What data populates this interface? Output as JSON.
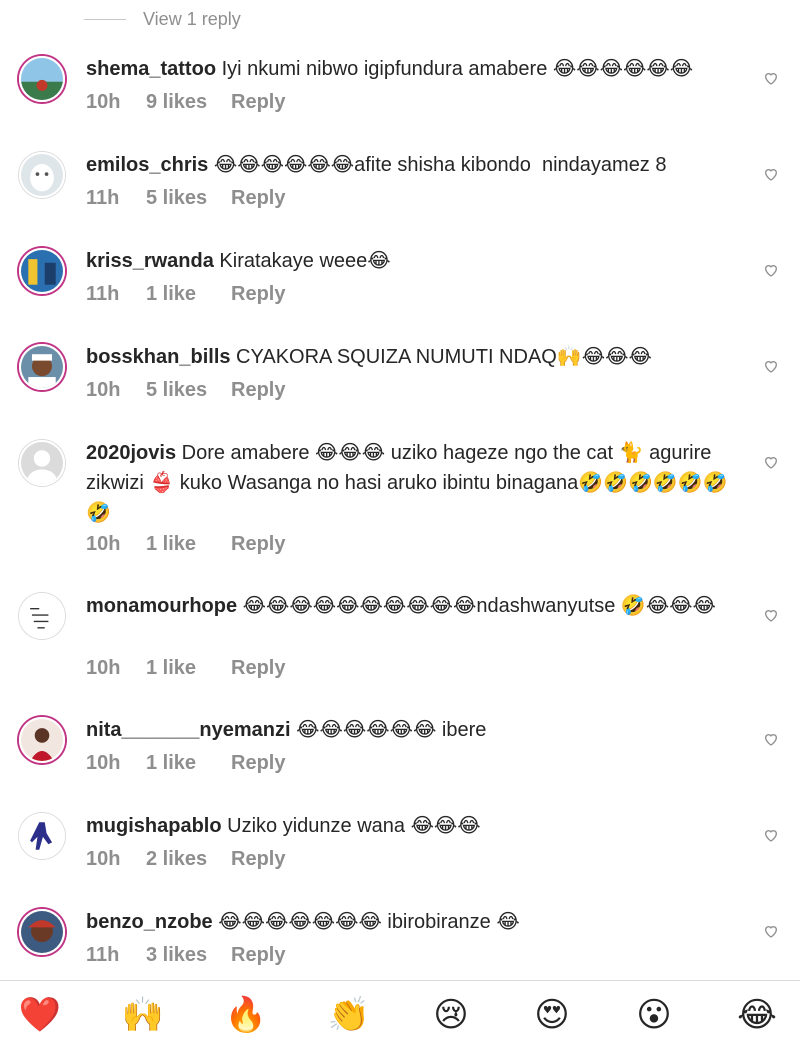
{
  "thread": {
    "view_replies": "View 1 reply"
  },
  "comments": [
    {
      "username": "shema_tattoo",
      "text": " Iyi nkumi nibwo igipfundura amabere 😂😂😂😂😂😂",
      "time": "10h",
      "likes": "9 likes",
      "reply": "Reply"
    },
    {
      "username": "emilos_chris",
      "text": " 😂😂😂😂😂😂afite shisha kibondo  nindayamez 8",
      "time": "11h",
      "likes": "5 likes",
      "reply": "Reply"
    },
    {
      "username": "kriss_rwanda",
      "text": " Kiratakaye weee😂",
      "time": "11h",
      "likes": "1 like",
      "reply": "Reply"
    },
    {
      "username": "bosskhan_bills",
      "text": " CYAKORA SQUIZA NUMUTI NDAQ🙌😂😂😂",
      "time": "10h",
      "likes": "5 likes",
      "reply": "Reply"
    },
    {
      "username": "2020jovis",
      "text": " Dore amabere 😂😂😂 uziko hageze ngo the cat 🐈 agurire zikwizi 👙 kuko Wasanga no hasi aruko ibintu binagana🤣🤣🤣🤣🤣🤣🤣",
      "time": "10h",
      "likes": "1 like",
      "reply": "Reply"
    },
    {
      "username": "monamourhope",
      "text": " 😂😂😂😂😂😂😂😂😂😂ndashwanyutse 🤣😂😂😂",
      "time": "10h",
      "likes": "1 like",
      "reply": "Reply"
    },
    {
      "username": "nita_______nyemanzi",
      "text": " 😂😂😂😂😂😂 ibere",
      "time": "10h",
      "likes": "1 like",
      "reply": "Reply"
    },
    {
      "username": "mugishapablo",
      "text": " Uziko yidunze wana 😂😂😂",
      "time": "10h",
      "likes": "2 likes",
      "reply": "Reply"
    },
    {
      "username": "benzo_nzobe",
      "text": " 😂😂😂😂😂😂😂 ibirobiranze 😂",
      "time": "11h",
      "likes": "3 likes",
      "reply": "Reply"
    }
  ],
  "reactions": [
    "❤️",
    "🙌",
    "🔥",
    "👏",
    "😢",
    "😍",
    "😮",
    "😂"
  ],
  "colors": {
    "accent_ring": "#c13584",
    "secondary_text": "#8e8e8e",
    "primary_text": "#262626"
  }
}
